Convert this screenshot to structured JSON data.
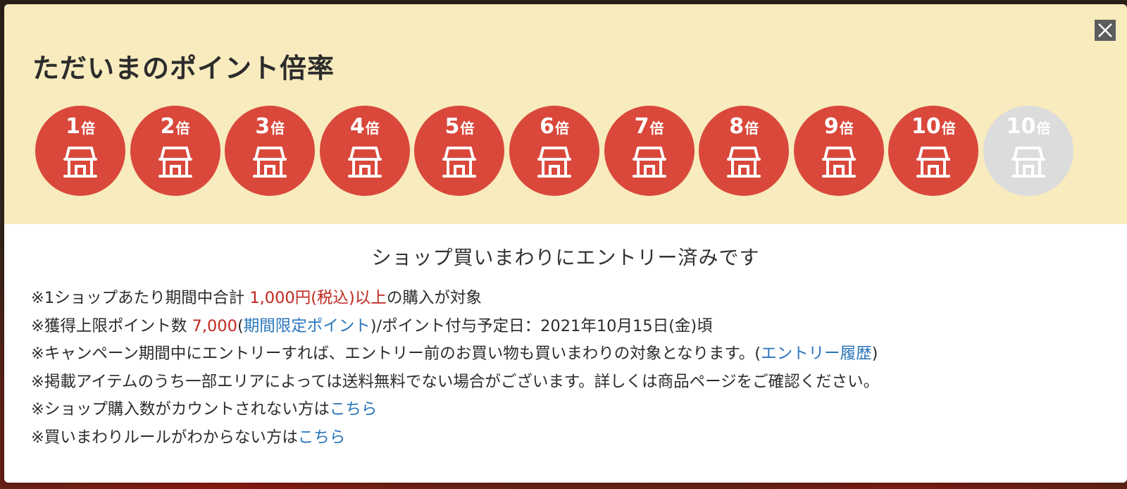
{
  "colors": {
    "header_bg": "#f8ebbd",
    "badge_active": "#d9483b",
    "badge_inactive": "#dcdcdc",
    "emphasis_red": "#c0281f",
    "link_blue": "#2a75bb"
  },
  "modal": {
    "close_icon": "close-icon",
    "title": "ただいまのポイント倍率",
    "badges": [
      {
        "num": "1",
        "unit": "倍",
        "active": true,
        "icon": "shop-icon"
      },
      {
        "num": "2",
        "unit": "倍",
        "active": true,
        "icon": "shop-icon"
      },
      {
        "num": "3",
        "unit": "倍",
        "active": true,
        "icon": "shop-icon"
      },
      {
        "num": "4",
        "unit": "倍",
        "active": true,
        "icon": "shop-icon"
      },
      {
        "num": "5",
        "unit": "倍",
        "active": true,
        "icon": "shop-icon"
      },
      {
        "num": "6",
        "unit": "倍",
        "active": true,
        "icon": "shop-icon"
      },
      {
        "num": "7",
        "unit": "倍",
        "active": true,
        "icon": "shop-icon"
      },
      {
        "num": "8",
        "unit": "倍",
        "active": true,
        "icon": "shop-icon"
      },
      {
        "num": "9",
        "unit": "倍",
        "active": true,
        "icon": "shop-icon"
      },
      {
        "num": "10",
        "unit": "倍",
        "active": true,
        "icon": "shop-icon"
      },
      {
        "num": "10",
        "unit": "倍",
        "active": false,
        "icon": "shop-icon"
      }
    ],
    "subtitle": "ショップ買いまわりにエントリー済みです",
    "notes": {
      "n1": {
        "a": "※1ショップあたり期間中合計 ",
        "b": "1,000円(税込)以上",
        "c": "の購入が対象"
      },
      "n2": {
        "a": "※獲得上限ポイント数 ",
        "b": "7,000",
        "c": "(",
        "link": "期間限定ポイント",
        "d": ")/ポイント付与予定日：2021年10月15日(金)頃"
      },
      "n3": {
        "a": "※キャンペーン期間中にエントリーすれば、エントリー前のお買い物も買いまわりの対象となります。(",
        "link": "エントリー履歴",
        "b": ")"
      },
      "n4": {
        "a": "※掲載アイテムのうち一部エリアによっては送料無料でない場合がございます。詳しくは商品ページをご確認ください。"
      },
      "n5": {
        "a": "※ショップ購入数がカウントされない方は",
        "link": "こちら"
      },
      "n6": {
        "a": "※買いまわりルールがわからない方は",
        "link": "こちら"
      }
    }
  }
}
